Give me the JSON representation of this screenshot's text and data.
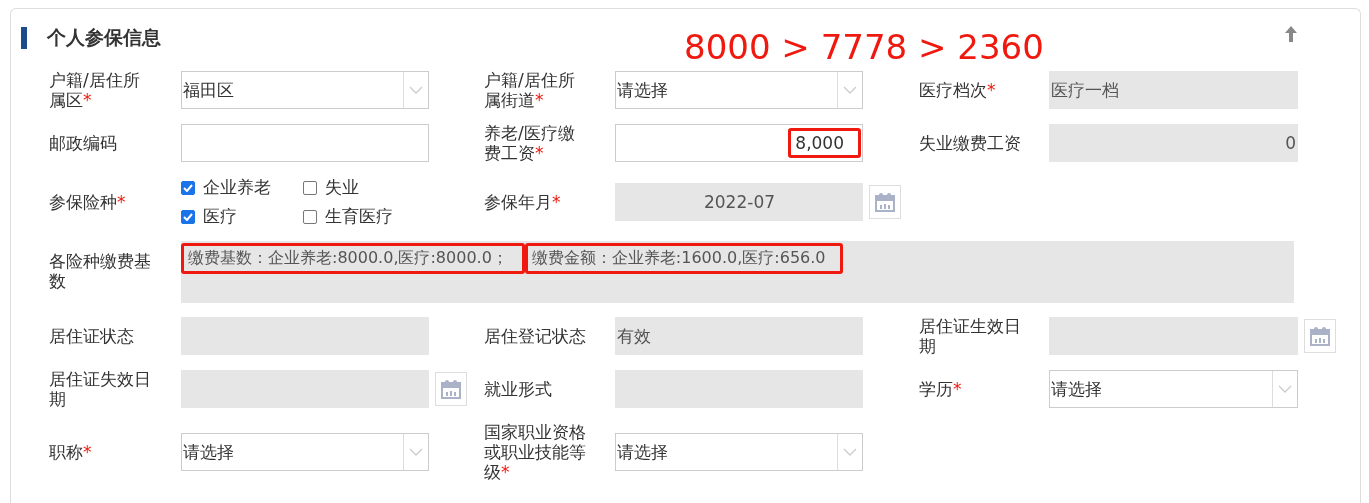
{
  "section": {
    "title": "个人参保信息",
    "annotation": "8000 > 7778 > 2360"
  },
  "rows": [
    {
      "fields": [
        {
          "label": "户籍/居住所属区",
          "required_mark": "*",
          "kind": "select",
          "value": "福田区"
        },
        {
          "label": "户籍/居住所属街道",
          "required_mark": "*",
          "kind": "select",
          "value": "请选择"
        },
        {
          "label": "医疗档次",
          "required_mark": "*",
          "kind": "readonly",
          "value": "医疗一档"
        }
      ]
    },
    {
      "fields": [
        {
          "label": "邮政编码",
          "kind": "text"
        },
        {
          "label": "养老/医疗缴费工资",
          "required_mark": "*",
          "kind": "text",
          "value": "8,000",
          "right_aligned": true,
          "highlighted": true
        },
        {
          "label": "失业缴费工资",
          "kind": "readonly",
          "value": "0",
          "right_aligned": true
        }
      ]
    },
    {
      "fields": [
        {
          "label": "参保险种",
          "required_mark": "*",
          "kind": "checks",
          "options": [
            {
              "label": "企业养老",
              "checked": true
            },
            {
              "label": "失业",
              "checked": false
            },
            {
              "label": "医疗",
              "checked": true
            },
            {
              "label": "生育医疗",
              "checked": false
            }
          ]
        },
        {
          "label": "参保年月",
          "required_mark": "*",
          "kind": "date",
          "value": "2022-07"
        }
      ]
    },
    {
      "fields": [
        {
          "label": "各险种缴费基数",
          "kind": "summary",
          "segments": [
            {
              "text": "缴费基数：企业养老:8000.0,医疗:8000.0；",
              "highlighted": true
            },
            {
              "text": "缴费金额：企业养老:1600.0,医疗:656.0",
              "highlighted": true
            }
          ]
        }
      ]
    },
    {
      "fields": [
        {
          "label": "居住证状态",
          "kind": "readonly"
        },
        {
          "label": "居住登记状态",
          "kind": "readonly",
          "value": "有效"
        },
        {
          "label": "居住证生效日期",
          "kind": "date"
        }
      ]
    },
    {
      "fields": [
        {
          "label": "居住证失效日期",
          "kind": "date"
        },
        {
          "label": "就业形式",
          "kind": "readonly"
        },
        {
          "label": "学历",
          "required_mark": "*",
          "kind": "select",
          "value": "请选择"
        }
      ]
    },
    {
      "fields": [
        {
          "label": "职称",
          "required_mark": "*",
          "kind": "select",
          "value": "请选择"
        },
        {
          "label": "国家职业资格或职业技能等级",
          "required_mark": "*",
          "kind": "select",
          "value": "请选择"
        }
      ]
    }
  ]
}
